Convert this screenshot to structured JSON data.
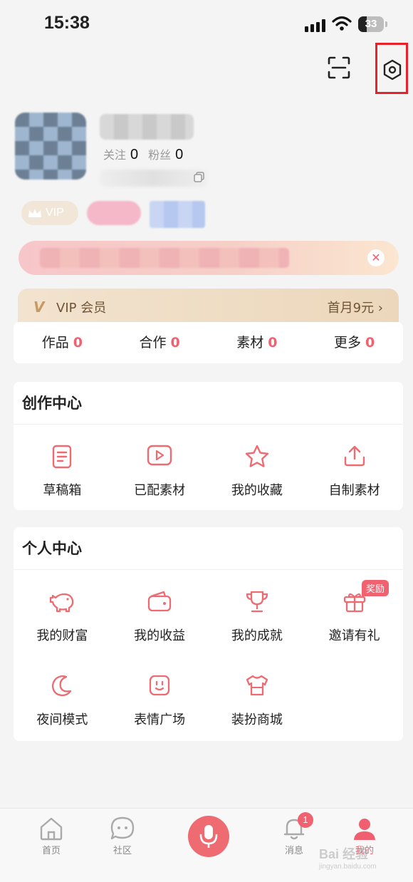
{
  "status_bar": {
    "time": "15:38",
    "battery": "33"
  },
  "profile": {
    "following_label": "关注",
    "following_count": "0",
    "fans_label": "粉丝",
    "fans_count": "0",
    "vip_badge": "VIP"
  },
  "vip_card": {
    "title": "VIP 会员",
    "promo": "首月9元 ›"
  },
  "works_bar": [
    {
      "label": "作品",
      "count": "0"
    },
    {
      "label": "合作",
      "count": "0"
    },
    {
      "label": "素材",
      "count": "0"
    },
    {
      "label": "更多",
      "count": "0"
    }
  ],
  "creation_center": {
    "title": "创作中心",
    "items": [
      {
        "label": "草稿箱",
        "icon": "draft-icon"
      },
      {
        "label": "已配素材",
        "icon": "play-icon"
      },
      {
        "label": "我的收藏",
        "icon": "star-icon"
      },
      {
        "label": "自制素材",
        "icon": "upload-icon"
      }
    ]
  },
  "personal_center": {
    "title": "个人中心",
    "reward_badge": "奖励",
    "items": [
      {
        "label": "我的财富",
        "icon": "piggy-bank-icon"
      },
      {
        "label": "我的收益",
        "icon": "wallet-icon"
      },
      {
        "label": "我的成就",
        "icon": "trophy-icon"
      },
      {
        "label": "邀请有礼",
        "icon": "gift-icon"
      },
      {
        "label": "夜间模式",
        "icon": "moon-icon"
      },
      {
        "label": "表情广场",
        "icon": "emoji-icon"
      },
      {
        "label": "装扮商城",
        "icon": "shirt-icon"
      }
    ]
  },
  "tabbar": {
    "home": "首页",
    "community": "社区",
    "messages": "消息",
    "messages_badge": "1",
    "me": "我的"
  },
  "watermark": {
    "line1": "Bai 经验",
    "line2": "jingyan.baidu.com"
  },
  "colors": {
    "accent": "#f0626f",
    "highlight_box": "#e8222b",
    "vip_gold": "#c69b63"
  }
}
